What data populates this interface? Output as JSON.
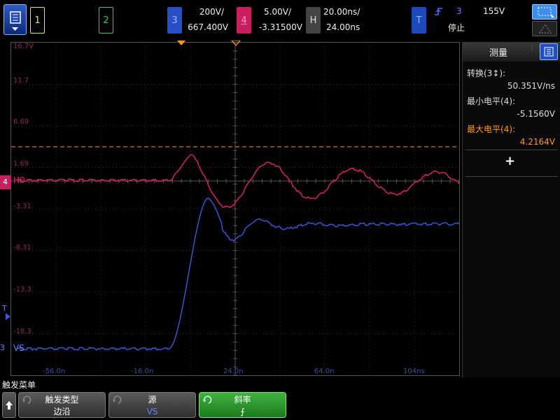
{
  "colors": {
    "ch1": "#e8e84a",
    "ch2": "#2fcf5a",
    "ch3": "#3b5bd9",
    "ch4": "#e0226f",
    "trigger": "#ff9a1a",
    "accent": "#2060d0"
  },
  "top": {
    "ch1": {
      "number": "1"
    },
    "ch2": {
      "number": "2"
    },
    "ch3": {
      "number": "3",
      "scale": "200V/",
      "offset": "667.400V"
    },
    "ch4": {
      "number": "4",
      "scale": "5.00V/",
      "offset": "-3.31500V"
    },
    "horizontal": {
      "label": "H",
      "scale": "20.00ns/",
      "delay": "24.00ns"
    },
    "trigger": {
      "label": "T",
      "source": "3",
      "level": "155V",
      "status": "停止"
    }
  },
  "graticule": {
    "y_labels": [
      "16.7V",
      "11.7",
      "6.69",
      "1.69",
      "-3.31",
      "-8.31",
      "-13.3",
      "-18.3"
    ],
    "x_labels": [
      "-56.0n",
      "-16.0n",
      "24.0n",
      "64.0n",
      "104ns"
    ],
    "ch4_marker": "4",
    "ch4_ref": "H0",
    "ch3_marker": "3",
    "ch3_ref": "VS",
    "trigger_marker": "T"
  },
  "panel": {
    "title": "测量",
    "items": [
      {
        "label": "转换(3↕):",
        "value": "50.351V/ns",
        "color": "#dddddd"
      },
      {
        "label": "最小电平(4):",
        "value": "-5.1560V",
        "color": "#dddddd"
      },
      {
        "label": "最大电平(4):",
        "value": "4.2164V",
        "color": "#ff9a1a"
      }
    ],
    "add_symbol": "+"
  },
  "bottom": {
    "menu_title": "触发菜单",
    "softkeys": [
      {
        "label": "触发类型",
        "value": "边沿"
      },
      {
        "label": "源",
        "value": "VS"
      },
      {
        "label": "斜率",
        "value": "⨍"
      }
    ]
  }
}
